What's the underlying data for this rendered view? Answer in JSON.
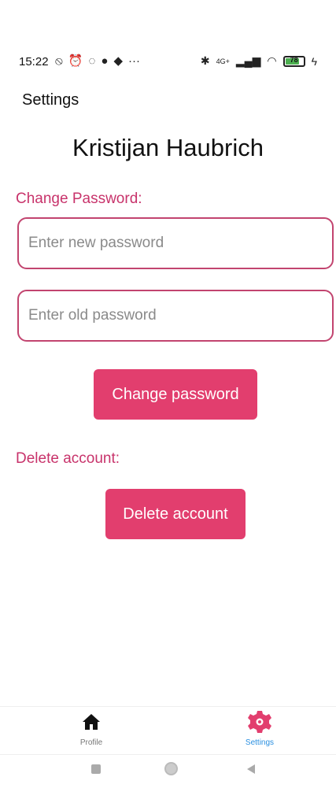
{
  "status_bar": {
    "time": "15:22",
    "left_icons": [
      "notifications-off-icon",
      "alarm-icon",
      "whatsapp-icon",
      "app-icon",
      "app-icon",
      "more-icon"
    ],
    "network": "4G+",
    "battery_level": "78"
  },
  "app_bar": {
    "title": "Settings"
  },
  "profile": {
    "name": "Kristijan Haubrich"
  },
  "change_password": {
    "label": "Change Password:",
    "new_placeholder": "Enter new password",
    "old_placeholder": "Enter old password",
    "new_value": "",
    "old_value": "",
    "button_label": "Change password"
  },
  "delete_account": {
    "label": "Delete account:",
    "button_label": "Delete account"
  },
  "bottom_nav": {
    "items": [
      {
        "label": "Profile",
        "icon": "home-icon",
        "active": false
      },
      {
        "label": "Settings",
        "icon": "gear-icon",
        "active": true
      }
    ]
  },
  "colors": {
    "accent": "#e23e6e",
    "label": "#c8336b",
    "field_border": "#c2446f",
    "active_tab": "#2a8fe0"
  }
}
